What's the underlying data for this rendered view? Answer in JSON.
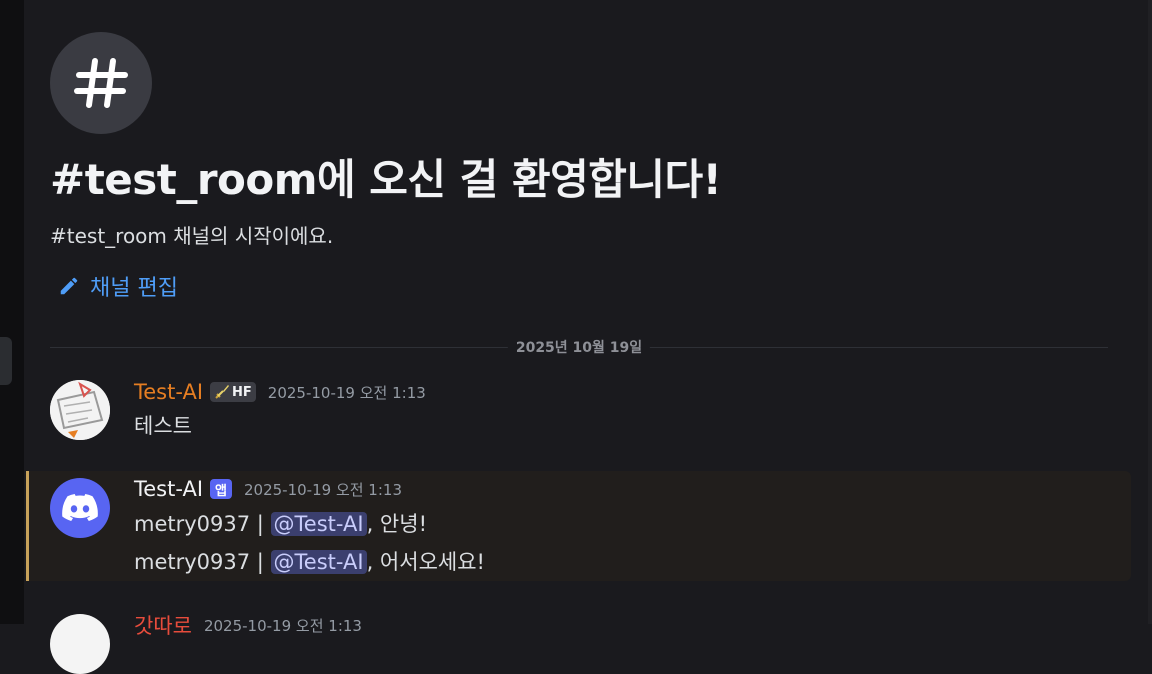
{
  "channel": {
    "welcome_title": "#test_room에 오신 걸 환영합니다!",
    "welcome_subtitle": "#test_room 채널의 시작이에요.",
    "edit_label": "채널 편집"
  },
  "date_divider": "2025년 10월 19일",
  "messages": [
    {
      "username": "Test-AI",
      "username_color": "#e67e22",
      "badge": "HF",
      "timestamp": "2025-10-19 오전 1:13",
      "text": "테스트"
    },
    {
      "username": "Test-AI",
      "username_color": "#f2f3f5",
      "badge": "앱",
      "timestamp": "2025-10-19 오전 1:13",
      "lines": [
        {
          "prefix": "metry0937 | ",
          "mention": "@Test-AI",
          "suffix": ", 안녕!"
        },
        {
          "prefix": "metry0937 | ",
          "mention": "@Test-AI",
          "suffix": ", 어서오세요!"
        }
      ]
    },
    {
      "username": "갓따로",
      "username_color": "#e74c3c",
      "timestamp": "2025-10-19 오전 1:13"
    }
  ],
  "colors": {
    "background": "#1a1a1e",
    "link_blue": "#4f9df7",
    "app_badge": "#5865f2",
    "mention_highlight": "#c8a25a"
  }
}
